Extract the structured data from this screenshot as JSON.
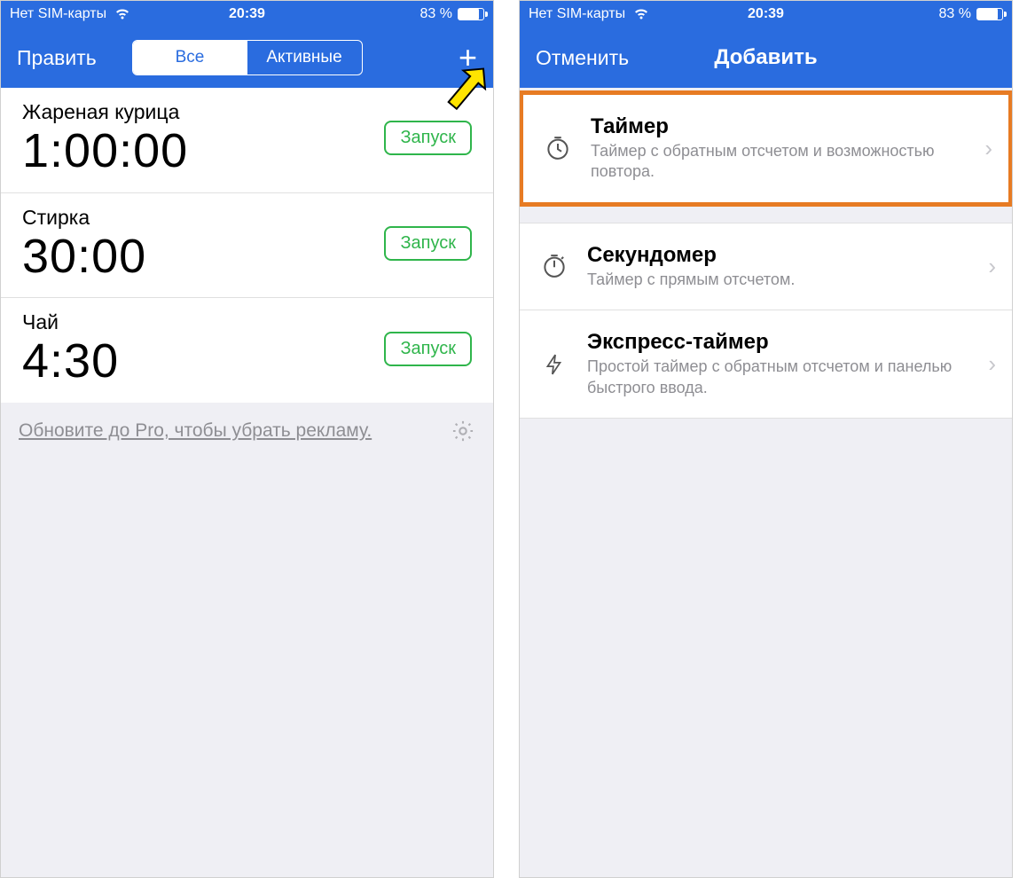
{
  "status": {
    "carrier": "Нет SIM-карты",
    "time": "20:39",
    "battery_pct": "83 %"
  },
  "left_screen": {
    "nav": {
      "edit_label": "Править",
      "segment_all": "Все",
      "segment_active": "Активные"
    },
    "timers": [
      {
        "name": "Жареная курица",
        "time": "1:00:00",
        "start": "Запуск"
      },
      {
        "name": "Стирка",
        "time": "30:00",
        "start": "Запуск"
      },
      {
        "name": "Чай",
        "time": "4:30",
        "start": "Запуск"
      }
    ],
    "upgrade_text": "Обновите до Pro, чтобы убрать рекламу."
  },
  "right_screen": {
    "nav": {
      "cancel_label": "Отменить",
      "title": "Добавить"
    },
    "options": [
      {
        "title": "Таймер",
        "desc": "Таймер с обратным отсчетом и возможностью повтора."
      },
      {
        "title": "Секундомер",
        "desc": "Таймер с прямым отсчетом."
      },
      {
        "title": "Экспресс-таймер",
        "desc": "Простой таймер с обратным отсчетом и панелью быстрого ввода."
      }
    ]
  }
}
